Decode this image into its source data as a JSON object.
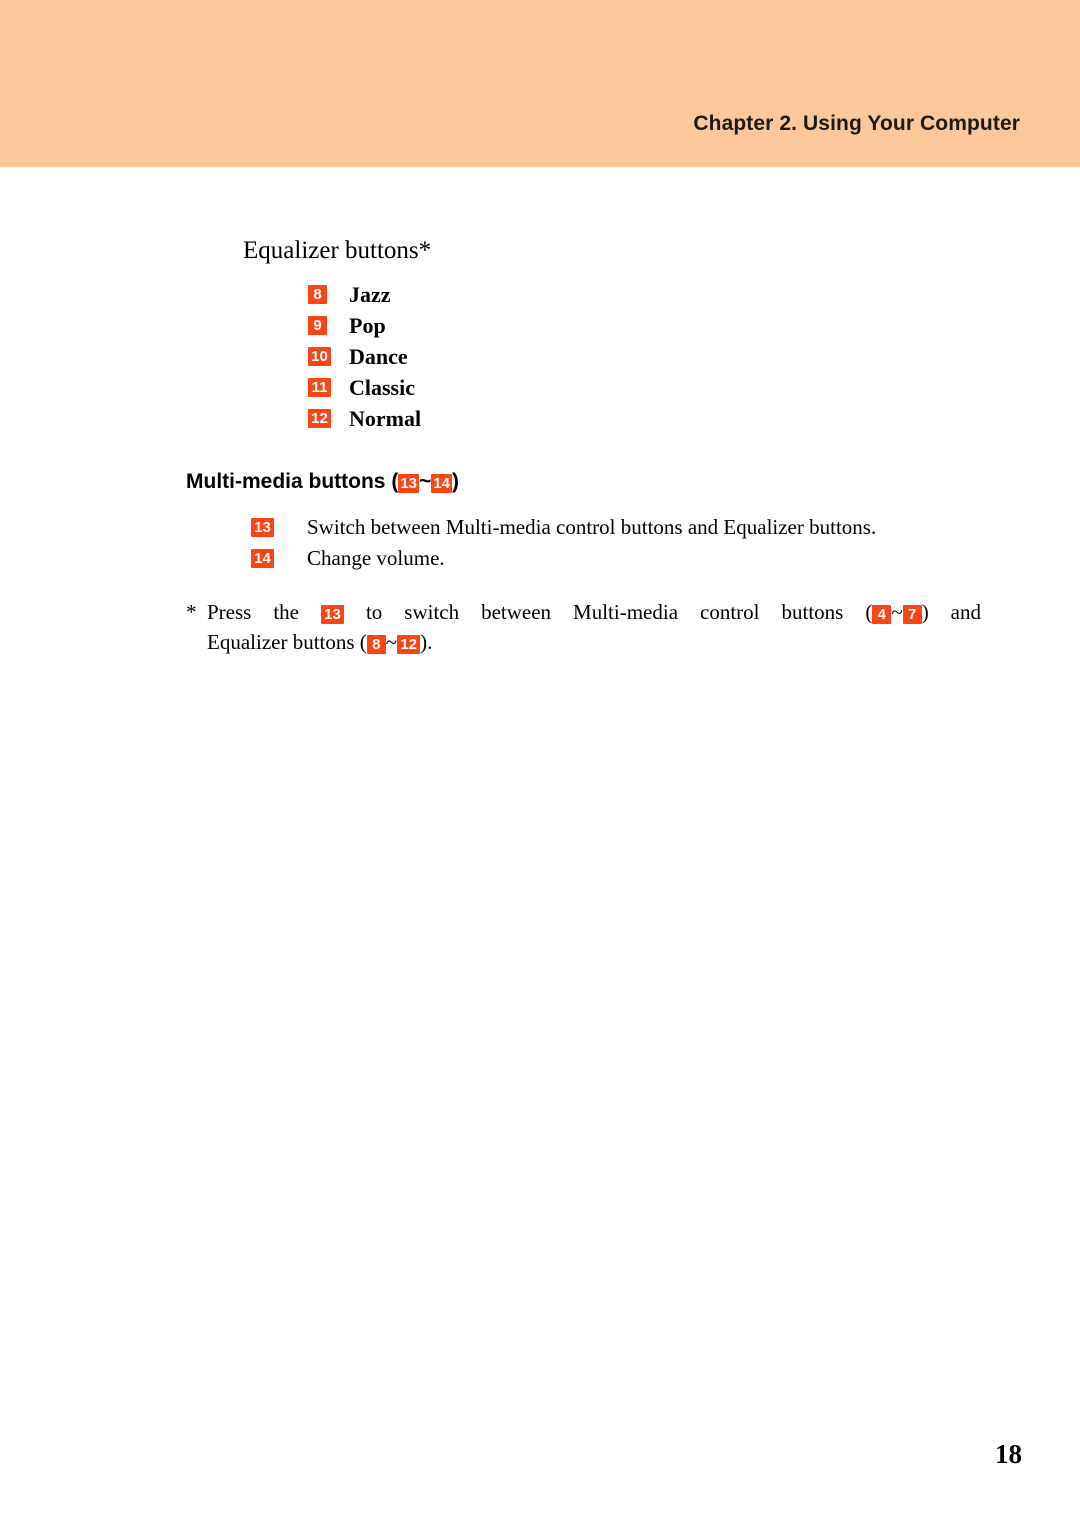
{
  "header": {
    "title": "Chapter 2. Using Your Computer",
    "band_color": "#fcc79a"
  },
  "badge_color": "#fa4616",
  "equalizer": {
    "intro": "Equalizer buttons*",
    "items": [
      {
        "number": "8",
        "label": "Jazz"
      },
      {
        "number": "9",
        "label": "Pop"
      },
      {
        "number": "10",
        "label": "Dance"
      },
      {
        "number": "11",
        "label": "Classic"
      },
      {
        "number": "12",
        "label": "Normal"
      }
    ]
  },
  "multimedia": {
    "heading_text": "Multi-media buttons",
    "heading_open_paren": "(",
    "heading_badge_from": "13",
    "heading_tilde": "~",
    "heading_badge_to": "14",
    "heading_close_paren": ")",
    "items": [
      {
        "number": "13",
        "text": "Switch between Multi-media control buttons and Equalizer buttons."
      },
      {
        "number": "14",
        "text": "Change volume."
      }
    ]
  },
  "footnote": {
    "star": "*",
    "w1": "Press",
    "w2": "the",
    "badge_switch": "13",
    "w3": "to",
    "w4": "switch",
    "w5": "between",
    "w6": "Multi-media",
    "w7": "control",
    "w8": "buttons",
    "open_paren1": "(",
    "badge_from1": "4",
    "tilde1": "~",
    "badge_to1": "7",
    "close_paren1": ")",
    "w9": "and",
    "line2_prefix": "Equalizer buttons (",
    "badge_from2": "8",
    "tilde2": "~",
    "badge_to2": "12",
    "line2_suffix": ")."
  },
  "page_number": "18"
}
